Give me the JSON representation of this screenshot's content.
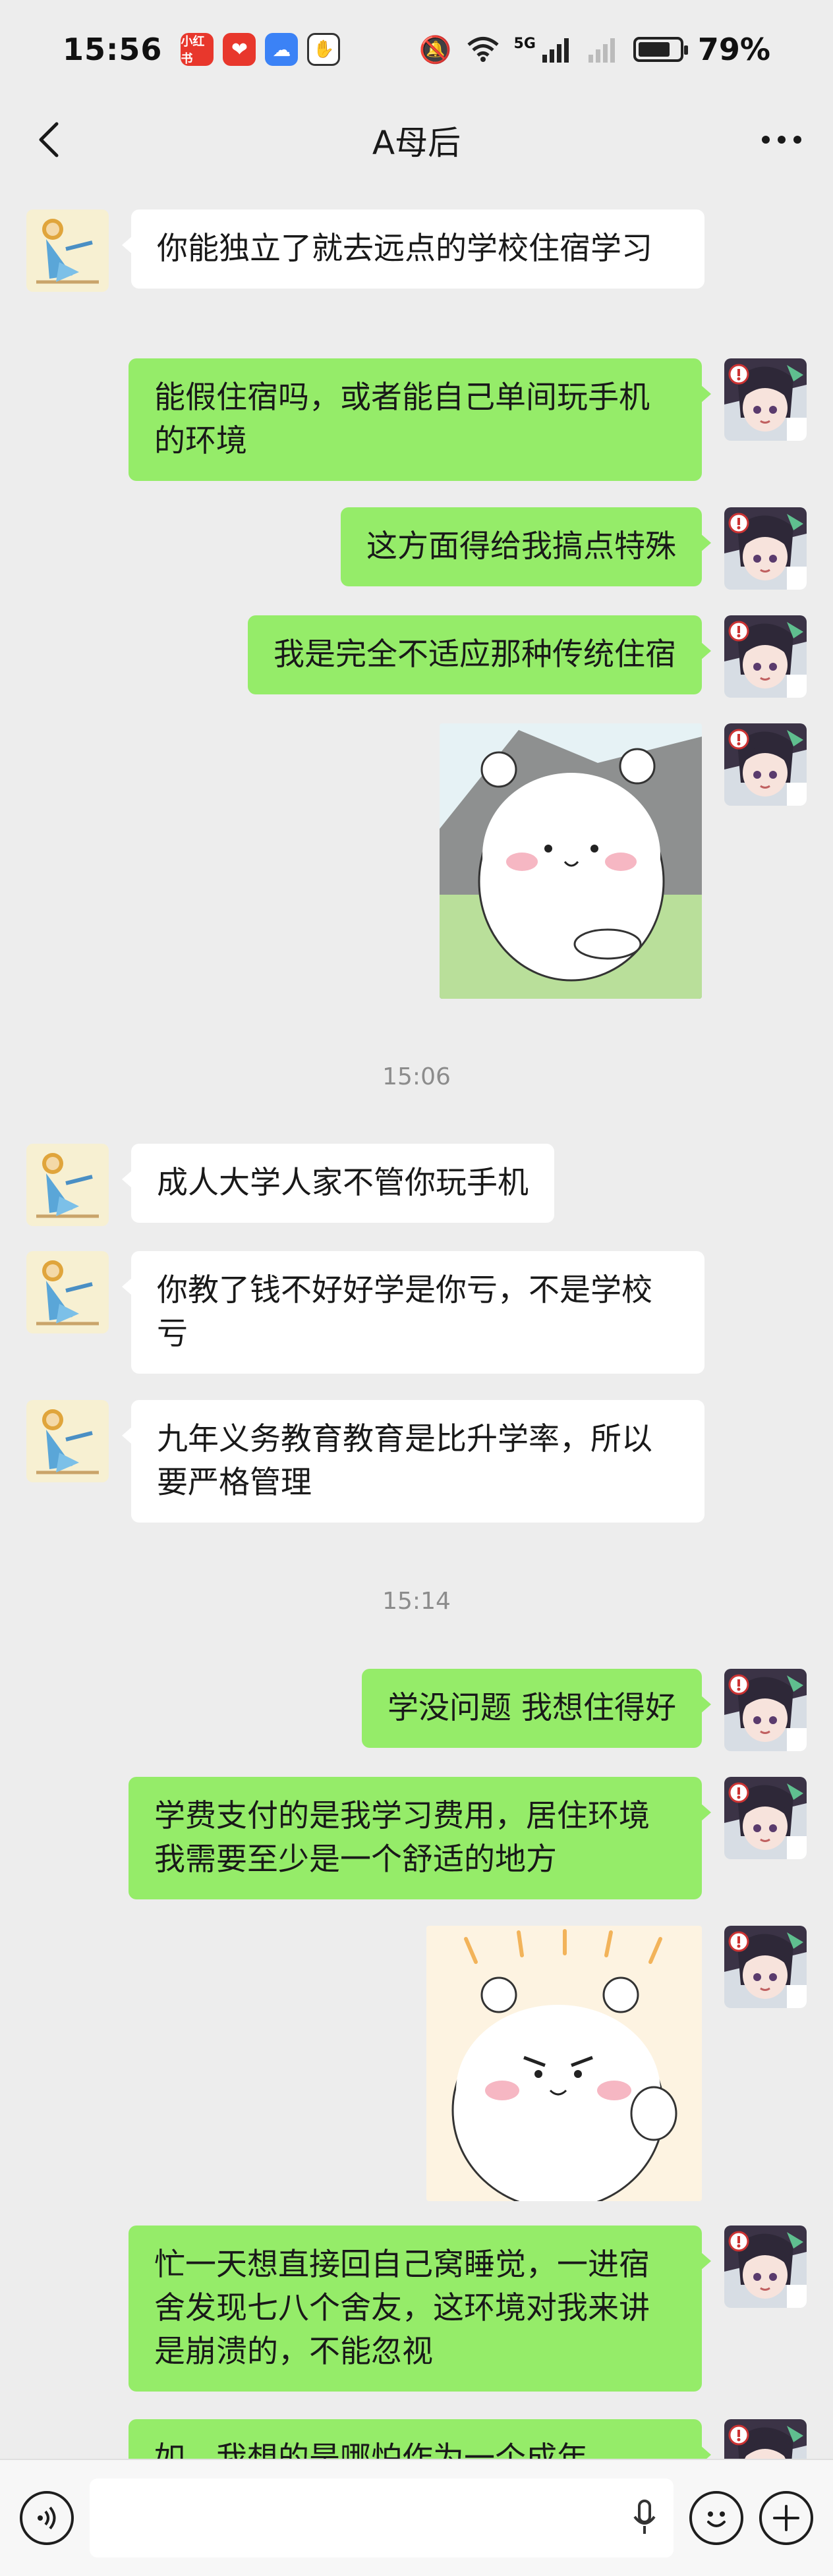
{
  "status_bar": {
    "time": "15:56",
    "network": "5G",
    "battery": "79%",
    "battery_level": 0.79,
    "icons": [
      "xiaohongshu-app-icon",
      "heart-app-icon",
      "weather-app-icon",
      "shield-app-icon",
      "mute-icon",
      "wifi-icon",
      "signal-icon",
      "signal-2-icon"
    ]
  },
  "nav": {
    "title": "A母后",
    "back_icon": "chevron-left-icon",
    "more_icon": "more-icon"
  },
  "messages": [
    {
      "side": "left",
      "text": "你能独立了就去远点的学校住宿学习"
    },
    {
      "side": "right",
      "text": "能假住宿吗，或者能自己单间玩手机的环境"
    },
    {
      "side": "right",
      "text": "这方面得给我搞点特殊"
    },
    {
      "side": "right",
      "text": "我是完全不适应那种传统住宿"
    },
    {
      "side": "right",
      "type": "sticker",
      "sticker": "chiikawa-sticker-happy"
    },
    {
      "type": "time",
      "text": "15:06"
    },
    {
      "side": "left",
      "text": "成人大学人家不管你玩手机"
    },
    {
      "side": "left",
      "text": "你教了钱不好好学是你亏，不是学校亏"
    },
    {
      "side": "left",
      "text": "九年义务教育教育是比升学率，所以要严格管理"
    },
    {
      "type": "time",
      "text": "15:14"
    },
    {
      "side": "right",
      "text": "学没问题 我想住得好"
    },
    {
      "side": "right",
      "text": "学费支付的是我学习费用，居住环境我需要至少是一个舒适的地方"
    },
    {
      "side": "right",
      "type": "sticker",
      "sticker": "chiikawa-sticker-fist"
    },
    {
      "side": "right",
      "text": "忙一天想直接回自己窝睡觉，一进宿舍发现七八个舍友，这环境对我来讲是崩溃的，不能忽视"
    },
    {
      "side": "right",
      "text": "如，我想的是哪怕作为一个成年"
    }
  ],
  "input_bar": {
    "voice_icon": "voice-icon",
    "mic_icon": "microphone-icon",
    "emoji_icon": "emoji-icon",
    "plus_icon": "plus-icon"
  }
}
